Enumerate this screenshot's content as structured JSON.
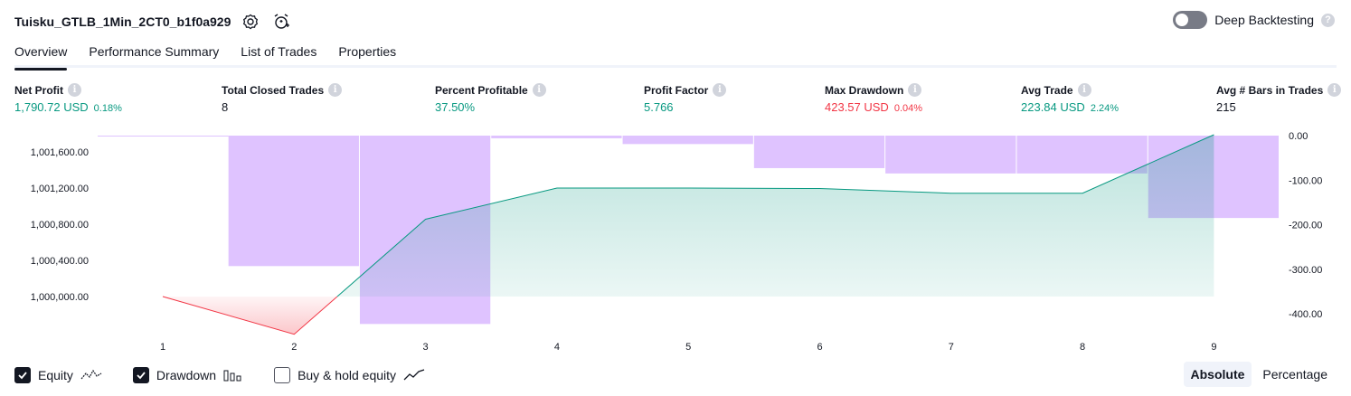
{
  "header": {
    "title": "Tuisku_GTLB_1Min_2CT0_b1f0a929",
    "deep_backtesting_label": "Deep Backtesting"
  },
  "tabs": [
    {
      "label": "Overview",
      "active": true
    },
    {
      "label": "Performance Summary",
      "active": false
    },
    {
      "label": "List of Trades",
      "active": false
    },
    {
      "label": "Properties",
      "active": false
    }
  ],
  "metrics": {
    "net_profit": {
      "label": "Net Profit",
      "value": "1,790.72 USD",
      "pct": "0.18%"
    },
    "total_closed_trades": {
      "label": "Total Closed Trades",
      "value": "8"
    },
    "percent_profitable": {
      "label": "Percent Profitable",
      "value": "37.50%"
    },
    "profit_factor": {
      "label": "Profit Factor",
      "value": "5.766"
    },
    "max_drawdown": {
      "label": "Max Drawdown",
      "value": "423.57 USD",
      "pct": "0.04%"
    },
    "avg_trade": {
      "label": "Avg Trade",
      "value": "223.84 USD",
      "pct": "2.24%"
    },
    "avg_bars": {
      "label": "Avg # Bars in Trades",
      "value": "215"
    }
  },
  "legend": {
    "equity": "Equity",
    "drawdown": "Drawdown",
    "buy_hold": "Buy & hold equity"
  },
  "mode": {
    "absolute": "Absolute",
    "percentage": "Percentage"
  },
  "colors": {
    "equity_up": "#089981",
    "equity_down": "#f23645",
    "drawdown_bar": "#d9b8ff",
    "text_green": "#089981",
    "text_red": "#f23645"
  },
  "chart_data": {
    "type": "area",
    "x": [
      "1",
      "2",
      "3",
      "4",
      "5",
      "6",
      "7",
      "8",
      "9"
    ],
    "equity": [
      1000000,
      999583,
      1000855,
      1001200,
      1001200,
      1001195,
      1001143,
      1001143,
      1001790
    ],
    "drawdown_categories": [
      "1",
      "2",
      "3",
      "4",
      "5",
      "6",
      "7",
      "8",
      "9"
    ],
    "drawdown": [
      -0.5,
      -293,
      -423,
      -6,
      -19,
      -73,
      -85,
      -85,
      -185
    ],
    "y_left_ticks": [
      "1,001,600.00",
      "1,001,200.00",
      "1,000,800.00",
      "1,000,400.00",
      "1,000,000.00"
    ],
    "y_left_values": [
      1001600,
      1001200,
      1000800,
      1000400,
      1000000
    ],
    "y_right_ticks": [
      "0.00",
      "-100.00",
      "-200.00",
      "-300.00",
      "-400.00"
    ],
    "y_right_values": [
      0,
      -100,
      -200,
      -300,
      -400
    ]
  }
}
